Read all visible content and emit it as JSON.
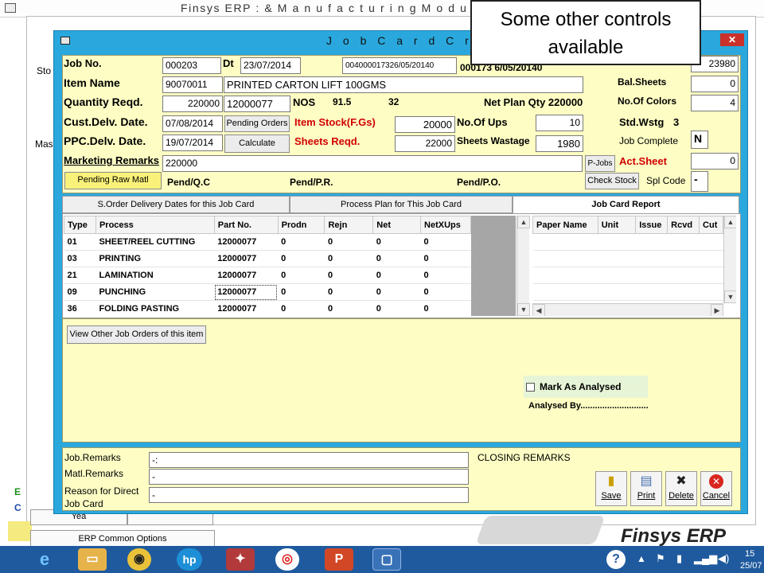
{
  "top_title": "Finsys ERP : & M a n u f a c t u r i n g  M o d u l e",
  "background": {
    "labels": [
      "Sto",
      "Mas",
      "E",
      "C"
    ],
    "buttons": [
      "Yea",
      "ERP Common Options"
    ]
  },
  "window": {
    "title": "J o b  C a r d  C r e a t i o n",
    "close_label": "✕"
  },
  "form": {
    "job_no_label": "Job No.",
    "job_no": "000203",
    "dt_label": "Dt",
    "dt": "23/07/2014",
    "order_ref": "004000017326/05/20140",
    "order_ref2": "000173 6/05/20140",
    "top_right_value": "23980",
    "item_name_label": "Item Name",
    "item_code": "90070011",
    "item_name": "PRINTED CARTON LIFT 100GMS",
    "bal_sheets_label": "Bal.Sheets",
    "bal_sheets": "0",
    "qty_label": "Quantity Reqd.",
    "qty": "220000",
    "qty2": "12000077",
    "nos_label": "NOS",
    "nos_val1": "91.5",
    "nos_val2": "32",
    "net_plan_label": "Net Plan Qty 220000",
    "no_colors_label": "No.Of Colors",
    "no_colors": "4",
    "cust_delv_label": "Cust.Delv. Date.",
    "cust_delv": "07/08/2014",
    "pending_orders_label": "Pending Orders",
    "item_stock_label": "Item Stock(F.Gs)",
    "item_stock": "20000",
    "no_ups_label": "No.Of Ups",
    "no_ups": "10",
    "std_wstg_label": "Std.Wstg",
    "std_wstg": "3",
    "ppc_delv_label": "PPC.Delv. Date.",
    "ppc_delv": "19/07/2014",
    "calculate_label": "Calculate",
    "sheets_reqd_label": "Sheets Reqd.",
    "sheets_reqd": "22000",
    "sheets_wastage_label": "Sheets Wastage",
    "sheets_wastage": "1980",
    "job_complete_label": "Job Complete",
    "job_complete": "N",
    "marketing_remarks_label": "Marketing Remarks",
    "marketing_remarks": "220000",
    "pjobs_label": "P-Jobs",
    "act_sheet_label": "Act.Sheet",
    "act_sheet": "0",
    "pending_raw_label": "Pending Raw Matl",
    "pend_qc_label": "Pend/Q.C",
    "pend_pr_label": "Pend/P.R.",
    "pend_po_label": "Pend/P.O.",
    "check_stock_label": "Check Stock",
    "spl_code_label": "Spl Code",
    "spl_code": "-"
  },
  "tabs": [
    {
      "label": "S.Order Delivery Dates for this Job Card"
    },
    {
      "label": "Process Plan for This Job Card"
    },
    {
      "label": "Job Card Report"
    }
  ],
  "process_grid": {
    "headers": [
      "Type",
      "Process",
      "Part No.",
      "Prodn",
      "Rejn",
      "Net",
      "NetXUps"
    ],
    "rows": [
      [
        "01",
        "SHEET/REEL CUTTING",
        "12000077",
        "0",
        "0",
        "0",
        "0"
      ],
      [
        "03",
        "PRINTING",
        "12000077",
        "0",
        "0",
        "0",
        "0"
      ],
      [
        "21",
        "LAMINATION",
        "12000077",
        "0",
        "0",
        "0",
        "0"
      ],
      [
        "09",
        "PUNCHING",
        "12000077",
        "0",
        "0",
        "0",
        "0"
      ],
      [
        "36",
        "FOLDING PASTING",
        "12000077",
        "0",
        "0",
        "0",
        "0"
      ]
    ]
  },
  "paper_grid": {
    "headers": [
      "Paper Name",
      "Unit",
      "Issue",
      "Rcvd",
      "Cut"
    ]
  },
  "mid": {
    "view_other_label": "View Other Job Orders of this item",
    "mark_analysed_label": "Mark As Analysed",
    "analysed_by_label": "Analysed By............................"
  },
  "bottom": {
    "job_remarks_label": "Job.Remarks",
    "job_remarks": "-:",
    "matl_remarks_label": "Matl.Remarks",
    "matl_remarks": "-",
    "reason_label_1": "Reason for Direct",
    "reason_label_2": "Job Card",
    "reason": "-",
    "closing_remarks_label": "CLOSING REMARKS",
    "save_label": "Save",
    "print_label": "Print",
    "delete_label": "Delete",
    "cancel_label": "Cancel"
  },
  "callout_text": "Some other controls available",
  "brand_text": "Finsys ERP",
  "taskbar": {
    "time": "15",
    "date": "25/07"
  },
  "colors": {
    "form_bg": "#fdfdc4",
    "window_bg": "#2aa8de",
    "red_label": "#d20000",
    "taskbar": "#1f5a9e"
  }
}
